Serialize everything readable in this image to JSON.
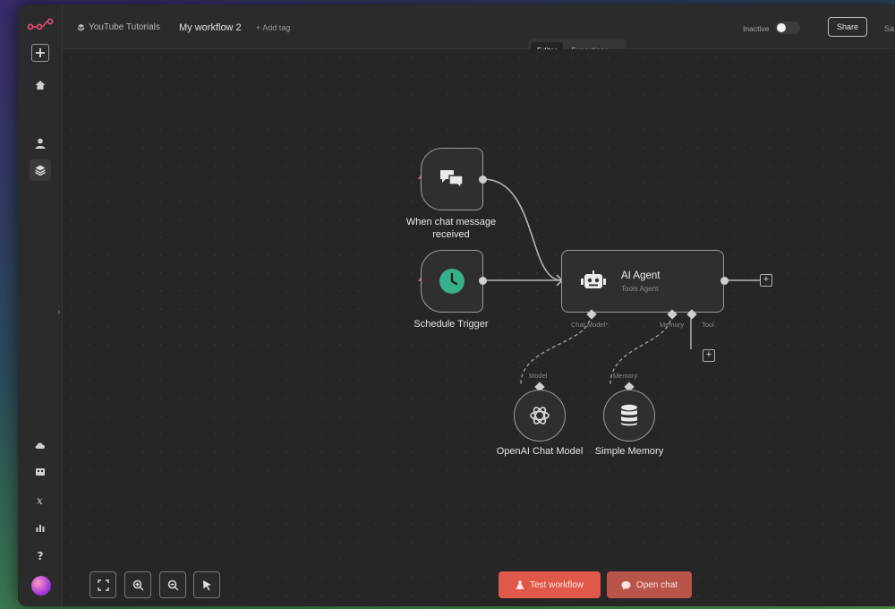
{
  "window": {
    "bg_frame": "#252525"
  },
  "header": {
    "project": "YouTube Tutorials",
    "workflow_name": "My workflow 2",
    "add_tag": "+ Add tag",
    "status_label": "Inactive",
    "share_label": "Share",
    "save_label": "Sa"
  },
  "tabs": [
    {
      "label": "Editor",
      "active": true
    },
    {
      "label": "Executions",
      "active": false
    }
  ],
  "sidebar": {
    "top_icons": [
      "plus-icon",
      "home-icon",
      "user-icon",
      "layers-icon"
    ],
    "bottom_icons": [
      "cloud-icon",
      "template-icon",
      "variables-icon",
      "insights-icon",
      "help-icon"
    ]
  },
  "nodes": {
    "chat_trigger": {
      "label": "When chat message received",
      "icon": "chat-bubbles-icon"
    },
    "schedule_trigger": {
      "label": "Schedule Trigger",
      "icon": "clock-icon",
      "icon_color": "#35b08a"
    },
    "agent": {
      "title": "AI Agent",
      "subtitle": "Tools Agent",
      "icon": "robot-icon",
      "ports": {
        "chat_model": "Chat Model*",
        "memory": "Memory",
        "tool": "Tool"
      }
    },
    "openai": {
      "label": "OpenAI Chat Model",
      "port": "Model",
      "icon": "openai-icon"
    },
    "memory": {
      "label": "Simple Memory",
      "port": "Memory",
      "icon": "database-icon"
    }
  },
  "footer": {
    "test_workflow": "Test workflow",
    "open_chat": "Open chat",
    "accent": "#e0584a"
  }
}
